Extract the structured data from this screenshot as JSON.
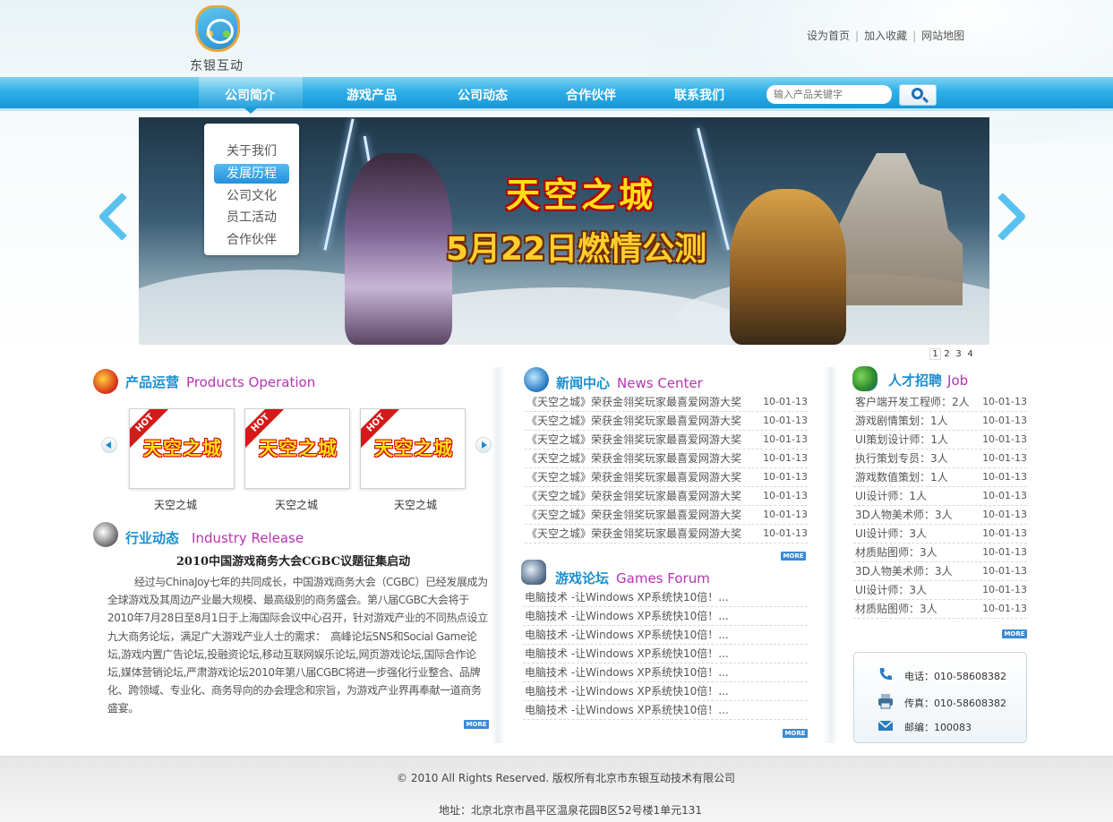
{
  "brand": {
    "name": "东银互动"
  },
  "top_links": [
    "设为首页",
    "加入收藏",
    "网站地图"
  ],
  "nav": [
    {
      "label": "公司简介"
    },
    {
      "label": "游戏产品"
    },
    {
      "label": "公司动态"
    },
    {
      "label": "合作伙伴"
    },
    {
      "label": "联系我们"
    }
  ],
  "search": {
    "placeholder": "输入产品关键字"
  },
  "dropdown": {
    "items": [
      "关于我们",
      "发展历程",
      "公司文化",
      "员工活动",
      "合作伙伴"
    ],
    "selected": "发展历程"
  },
  "banner": {
    "title": "天空之城",
    "subtitle": "5月22日燃情公测",
    "pages": [
      "1",
      "2",
      "3",
      "4"
    ],
    "current_page": "1"
  },
  "products": {
    "heading_zh": "产品运营",
    "heading_en": "Products Operation",
    "badge": "HOT",
    "items": [
      {
        "image_text": "天空之城",
        "label": "天空之城"
      },
      {
        "image_text": "天空之城",
        "label": "天空之城"
      },
      {
        "image_text": "天空之城",
        "label": "天空之城"
      }
    ]
  },
  "industry": {
    "heading_zh": "行业动态",
    "heading_en": "Industry Release",
    "article_title": "2010中国游戏商务大会CGBC议题征集启动",
    "article_body": "经过与ChinaJoy七年的共同成长，中国游戏商务大会（CGBC）已经发展成为全球游戏及其周边产业最大规模、最高级别的商务盛会。第八届CGBC大会将于2010年7月28日至8月1日于上海国际会议中心召开，针对游戏产业的不同热点设立九大商务论坛，满足广大游戏产业人士的需求：　高峰论坛SNS和Social Game论坛,游戏内置广告论坛,投融资论坛,移动互联网娱乐论坛,网页游戏论坛,国际合作论坛,媒体营销论坛,严肃游戏论坛2010年第八届CGBC将进一步强化行业整合、品牌化、跨领域、专业化、商务导向的办会理念和宗旨，为游戏产业界再奉献一道商务盛宴。"
  },
  "news": {
    "heading_zh": "新闻中心",
    "heading_en": "News Center",
    "items": [
      {
        "title": "《天空之城》荣获金翎奖玩家最喜爱网游大奖",
        "date": "10-01-13"
      },
      {
        "title": "《天空之城》荣获金翎奖玩家最喜爱网游大奖",
        "date": "10-01-13"
      },
      {
        "title": "《天空之城》荣获金翎奖玩家最喜爱网游大奖",
        "date": "10-01-13"
      },
      {
        "title": "《天空之城》荣获金翎奖玩家最喜爱网游大奖",
        "date": "10-01-13"
      },
      {
        "title": "《天空之城》荣获金翎奖玩家最喜爱网游大奖",
        "date": "10-01-13"
      },
      {
        "title": "《天空之城》荣获金翎奖玩家最喜爱网游大奖",
        "date": "10-01-13"
      },
      {
        "title": "《天空之城》荣获金翎奖玩家最喜爱网游大奖",
        "date": "10-01-13"
      },
      {
        "title": "《天空之城》荣获金翎奖玩家最喜爱网游大奖",
        "date": "10-01-13"
      }
    ]
  },
  "forum": {
    "heading_zh": "游戏论坛",
    "heading_en": "Games Forum",
    "items": [
      "电脑技术 -让Windows XP系统快10倍！...",
      "电脑技术 -让Windows XP系统快10倍！...",
      "电脑技术 -让Windows XP系统快10倍！...",
      "电脑技术 -让Windows XP系统快10倍！...",
      "电脑技术 -让Windows XP系统快10倍！...",
      "电脑技术 -让Windows XP系统快10倍！...",
      "电脑技术 -让Windows XP系统快10倍！..."
    ]
  },
  "jobs": {
    "heading_zh": "人才招聘",
    "heading_en": "Job",
    "items": [
      {
        "title": "客户端开发工程师：2人",
        "date": "10-01-13"
      },
      {
        "title": "游戏剧情策划：1人",
        "date": "10-01-13"
      },
      {
        "title": "UI策划设计师：1人",
        "date": "10-01-13"
      },
      {
        "title": "执行策划专员：3人",
        "date": "10-01-13"
      },
      {
        "title": "游戏数值策划：1人",
        "date": "10-01-13"
      },
      {
        "title": "UI设计师：1人",
        "date": "10-01-13"
      },
      {
        "title": "3D人物美术师：3人",
        "date": "10-01-13"
      },
      {
        "title": "UI设计师：3人",
        "date": "10-01-13"
      },
      {
        "title": "材质贴图师：3人",
        "date": "10-01-13"
      },
      {
        "title": "3D人物美术师：3人",
        "date": "10-01-13"
      },
      {
        "title": "UI设计师：3人",
        "date": "10-01-13"
      },
      {
        "title": "材质贴图师：3人",
        "date": "10-01-13"
      }
    ]
  },
  "more_label": "MORE",
  "contact": {
    "phone": "电话：010-58608382",
    "fax": "传真：010-58608382",
    "postcode": "邮编：100083"
  },
  "footer": {
    "copyright": "© 2010 All Rights Reserved.  版权所有北京市东银互动技术有限公司",
    "address": "地址：北京北京市昌平区温泉花园B区52号楼1单元131"
  },
  "colors": {
    "nav_blue": "#1597d6",
    "heading_blue": "#1c8fd0",
    "heading_purple": "#b535b0",
    "more_blue": "#3a8bd6"
  }
}
